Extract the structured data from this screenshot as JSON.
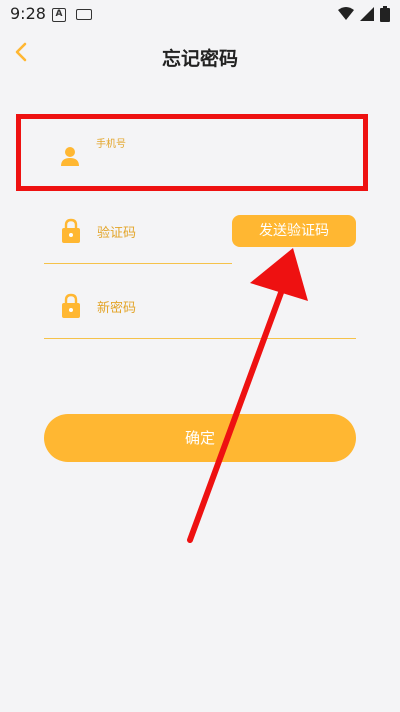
{
  "status_bar": {
    "time": "9:28",
    "icons": [
      "a-box-icon",
      "keyboard-icon",
      "wifi-icon",
      "signal-icon",
      "battery-icon"
    ]
  },
  "header": {
    "title": "忘记密码",
    "back_icon": "chevron-left-icon"
  },
  "form": {
    "phone": {
      "label": "手机号",
      "icon": "user-icon"
    },
    "code": {
      "placeholder": "验证码",
      "icon": "lock-icon",
      "send_button": "发送验证码"
    },
    "new_password": {
      "placeholder": "新密码",
      "icon": "lock-icon"
    },
    "confirm_button": "确定"
  },
  "colors": {
    "accent": "#ffb732",
    "annotation": "#ee1111",
    "background": "#f4f4f6"
  }
}
